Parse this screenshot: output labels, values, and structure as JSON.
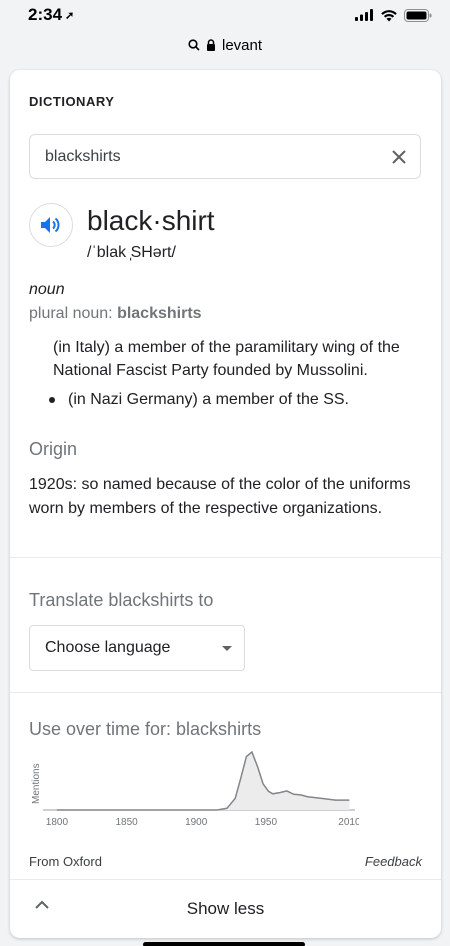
{
  "status": {
    "time": "2:34",
    "location_icon": "location-arrow-icon"
  },
  "url_bar": {
    "domain": "levant"
  },
  "dictionary": {
    "section_label": "DICTIONARY",
    "search_value": "blackshirts",
    "headword": "black·shirt",
    "phonetic": "/ˈblak ̩SHərt/",
    "part_of_speech": "noun",
    "plural_label": "plural noun: ",
    "plural_value": "blackshirts",
    "definitions": [
      "(in Italy) a member of the paramilitary wing of the National Fascist Party founded by Mussolini.",
      "(in Nazi Germany) a member of the SS."
    ],
    "origin_heading": "Origin",
    "origin_text": "1920s: so named because of the color of the uniforms worn by members of the respective organizations."
  },
  "translate": {
    "heading": "Translate blackshirts to",
    "select_value": "Choose language"
  },
  "usage": {
    "heading": "Use over time for: blackshirts",
    "chart_data": {
      "type": "area",
      "ylabel": "Mentions",
      "x_ticks": [
        "1800",
        "1850",
        "1900",
        "1950",
        "2010"
      ],
      "x": [
        1800,
        1850,
        1900,
        1915,
        1922,
        1928,
        1932,
        1936,
        1940,
        1944,
        1948,
        1952,
        1955,
        1960,
        1965,
        1970,
        1975,
        1980,
        1990,
        2000,
        2010
      ],
      "y": [
        0,
        0,
        0,
        0,
        0.03,
        0.2,
        0.55,
        0.92,
        1.0,
        0.75,
        0.45,
        0.32,
        0.28,
        0.3,
        0.33,
        0.27,
        0.26,
        0.23,
        0.2,
        0.17,
        0.17
      ],
      "ylim": [
        0,
        1
      ]
    }
  },
  "footer": {
    "source": "From Oxford",
    "feedback": "Feedback"
  },
  "show_less": "Show less",
  "colors": {
    "accent": "#1a73e8",
    "muted": "#70757a"
  }
}
